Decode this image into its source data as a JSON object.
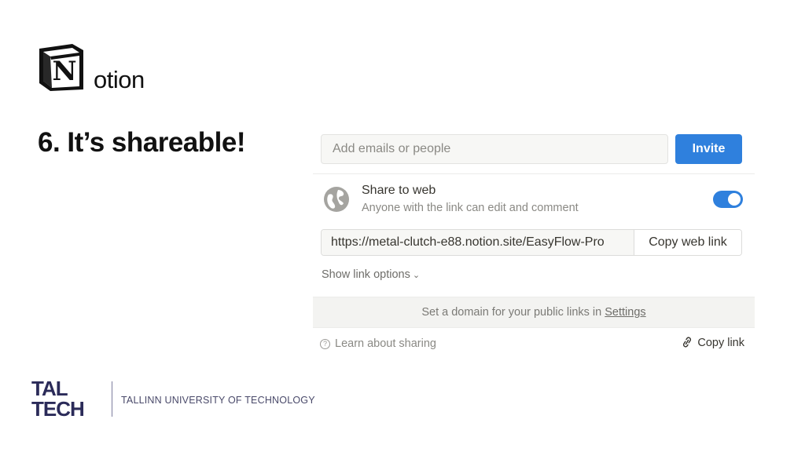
{
  "slide": {
    "logo_text": "otion",
    "logo_letter": "N",
    "title": "6. It’s shareable!"
  },
  "share_panel": {
    "email_placeholder": "Add emails or people",
    "invite_label": "Invite",
    "share_to_web": {
      "title": "Share to web",
      "subtitle": "Anyone with the link can edit and comment",
      "enabled": true
    },
    "link_url": "https://metal-clutch-e88.notion.site/EasyFlow-Pro",
    "copy_web_link_label": "Copy web link",
    "show_link_options_label": "Show link options",
    "domain_text": "Set a domain for your public links in ",
    "settings_link": "Settings",
    "learn_label": "Learn about sharing",
    "copy_link_label": "Copy link"
  },
  "footer": {
    "logo_line1": "TAL",
    "logo_line2": "TECH",
    "university": "TALLINN UNIVERSITY OF TECHNOLOGY"
  },
  "colors": {
    "accent": "#2f80dd",
    "text": "#37352f",
    "muted": "#8a8984",
    "taltech": "#2b2b59"
  },
  "icons": [
    "notion-logo-icon",
    "globe-icon",
    "chevron-down-icon",
    "help-circle-icon",
    "link-icon",
    "taltech-logo"
  ]
}
